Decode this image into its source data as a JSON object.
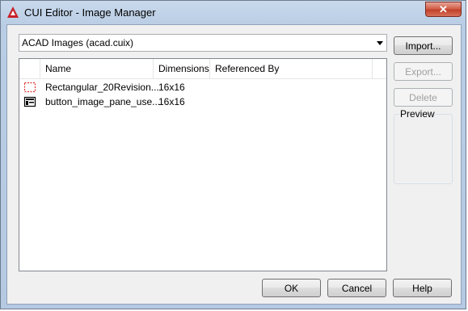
{
  "window": {
    "title": "CUI Editor - Image Manager",
    "close_glyph": "✕"
  },
  "source_combo": {
    "value": "ACAD Images (acad.cuix)"
  },
  "buttons": {
    "import": "Import...",
    "export": "Export...",
    "delete": "Delete",
    "ok": "OK",
    "cancel": "Cancel",
    "help": "Help"
  },
  "preview": {
    "label": "Preview"
  },
  "list": {
    "columns": {
      "name": "Name",
      "dimensions": "Dimensions",
      "referenced_by": "Referenced By"
    },
    "rows": [
      {
        "icon": "dashed-rectangle-icon",
        "name": "Rectangular_20Revision...",
        "dimensions": "16x16",
        "referenced_by": ""
      },
      {
        "icon": "pane-image-icon",
        "name": "button_image_pane_use...",
        "dimensions": "16x16",
        "referenced_by": ""
      }
    ]
  },
  "colors": {
    "accent_red": "#c1412a",
    "title_bg": "#b9cde4",
    "client_bg": "#f0f0f0"
  }
}
